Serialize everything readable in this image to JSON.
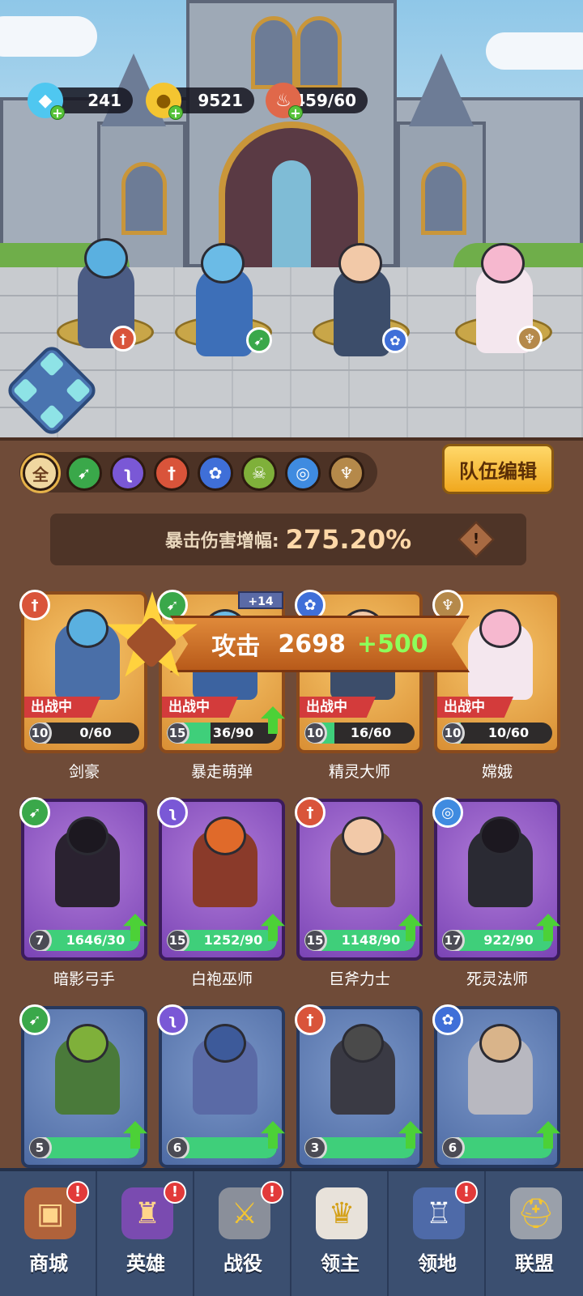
{
  "resources": {
    "gems": "241",
    "gold": "9521",
    "stamina": "459/60"
  },
  "filters": [
    {
      "label": "全",
      "icon": "all-icon"
    },
    {
      "label": "",
      "icon": "bow-icon"
    },
    {
      "label": "",
      "icon": "staff-icon"
    },
    {
      "label": "",
      "icon": "sword-icon"
    },
    {
      "label": "",
      "icon": "paw-icon"
    },
    {
      "label": "",
      "icon": "skull-icon"
    },
    {
      "label": "",
      "icon": "swirl-icon"
    },
    {
      "label": "",
      "icon": "wings-icon"
    }
  ],
  "edit_team_label": "队伍编辑",
  "crit": {
    "label": "暴击伤害增幅:",
    "value": "275.20%",
    "info": "!"
  },
  "attack": {
    "label": "攻击",
    "value": "2698",
    "bonus": "+500"
  },
  "deploy_label": "出战中",
  "weapon_bonus": "+14",
  "heroes": [
    {
      "name": "剑豪",
      "level": "10",
      "shards": "0/60",
      "progress": 0.0,
      "class": "sword-icon",
      "deployed": true
    },
    {
      "name": "暴走萌弹",
      "level": "15",
      "shards": "36/90",
      "progress": 0.4,
      "class": "bow-icon",
      "deployed": true
    },
    {
      "name": "精灵大师",
      "level": "10",
      "shards": "16/60",
      "progress": 0.27,
      "class": "paw-icon",
      "deployed": true
    },
    {
      "name": "嫦娥",
      "level": "10",
      "shards": "10/60",
      "progress": 0.17,
      "class": "wings-icon",
      "deployed": true
    },
    {
      "name": "暗影弓手",
      "level": "7",
      "shards": "1646/30",
      "progress": 1.0,
      "class": "bow-icon",
      "deployed": false
    },
    {
      "name": "白袍巫师",
      "level": "15",
      "shards": "1252/90",
      "progress": 1.0,
      "class": "staff-icon",
      "deployed": false
    },
    {
      "name": "巨斧力士",
      "level": "15",
      "shards": "1148/90",
      "progress": 1.0,
      "class": "sword-icon",
      "deployed": false
    },
    {
      "name": "死灵法师",
      "level": "17",
      "shards": "922/90",
      "progress": 1.0,
      "class": "swirl-icon",
      "deployed": false
    },
    {
      "name": "",
      "level": "5",
      "shards": "",
      "progress": 1.0,
      "class": "bow-icon",
      "deployed": false
    },
    {
      "name": "",
      "level": "6",
      "shards": "",
      "progress": 1.0,
      "class": "staff-icon",
      "deployed": false
    },
    {
      "name": "",
      "level": "3",
      "shards": "",
      "progress": 1.0,
      "class": "sword-icon",
      "deployed": false
    },
    {
      "name": "",
      "level": "6",
      "shards": "",
      "progress": 1.0,
      "class": "paw-icon",
      "deployed": false
    }
  ],
  "nav": [
    {
      "label": "商城",
      "alert": "!"
    },
    {
      "label": "英雄",
      "alert": "!"
    },
    {
      "label": "战役",
      "alert": "!"
    },
    {
      "label": "领主",
      "alert": ""
    },
    {
      "label": "领地",
      "alert": "!"
    },
    {
      "label": "联盟",
      "alert": ""
    }
  ],
  "colors": {
    "sword": "#d9543a",
    "bow": "#3aa84a",
    "staff": "#7a58d6",
    "paw": "#3f6fd8",
    "skull": "#7fb03a",
    "swirl": "#3f8be0",
    "wings": "#b5894a"
  }
}
